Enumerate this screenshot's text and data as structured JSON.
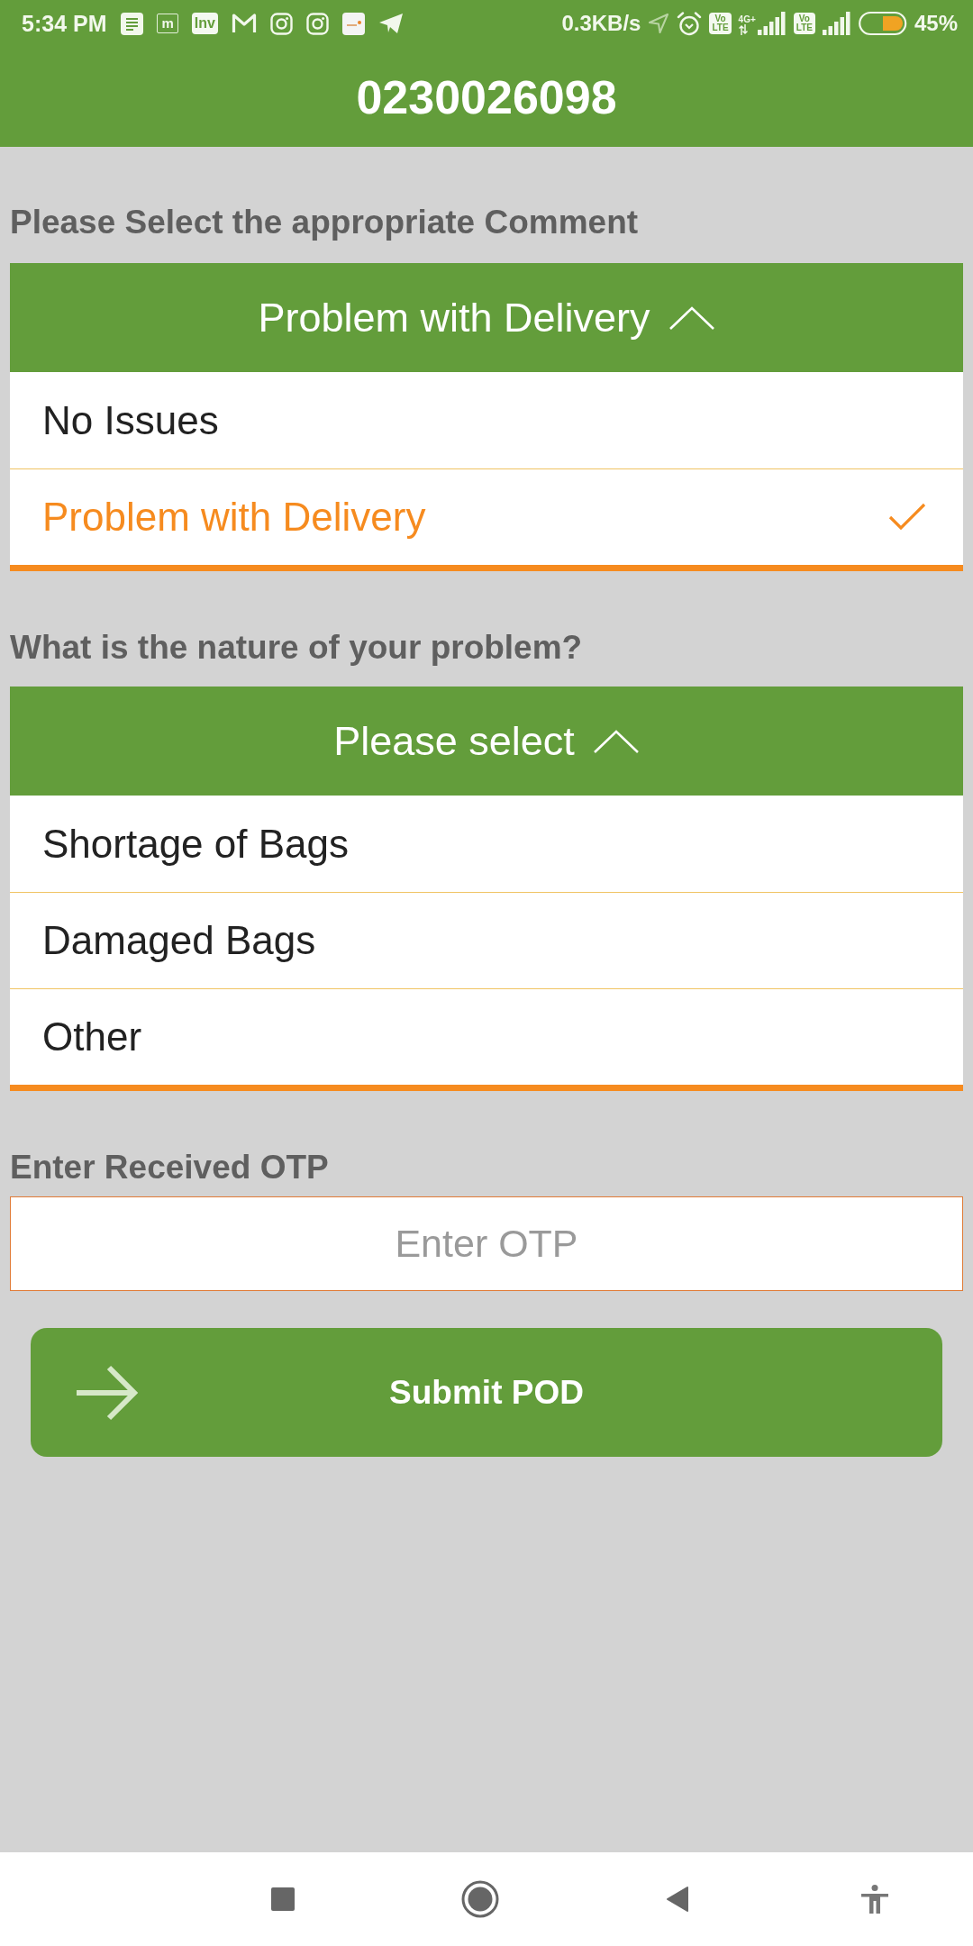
{
  "status_bar": {
    "time": "5:34 PM",
    "notification_icons": [
      {
        "kind": "document"
      },
      {
        "kind": "text_outline",
        "text": "m"
      },
      {
        "kind": "text_tile",
        "text": "Inv"
      },
      {
        "kind": "m_outline"
      },
      {
        "kind": "camera"
      },
      {
        "kind": "camera"
      },
      {
        "kind": "app_tile"
      },
      {
        "kind": "paper_plane"
      }
    ],
    "network_speed": "0.3KB/s",
    "sims": [
      {
        "volte": [
          "Vo",
          "LTE"
        ],
        "network_type": "4G+"
      },
      {
        "volte": [
          "Vo",
          "LTE"
        ]
      }
    ],
    "battery": "45%"
  },
  "app_bar": {
    "title": "0230026098"
  },
  "comment_section": {
    "label": "Please Select the appropriate Comment",
    "dropdown": {
      "header": "Problem with Delivery",
      "expanded": true,
      "options": [
        {
          "label": "No Issues",
          "selected": false
        },
        {
          "label": "Problem with Delivery",
          "selected": true
        }
      ]
    }
  },
  "problem_section": {
    "label": "What is the nature of your problem?",
    "dropdown": {
      "header": "Please select",
      "expanded": true,
      "options": [
        {
          "label": "Shortage of Bags",
          "selected": false
        },
        {
          "label": "Damaged Bags",
          "selected": false
        },
        {
          "label": "Other",
          "selected": false
        }
      ]
    }
  },
  "otp": {
    "label": "Enter Received OTP",
    "placeholder": "Enter OTP"
  },
  "submit_button": {
    "label": "Submit POD"
  }
}
